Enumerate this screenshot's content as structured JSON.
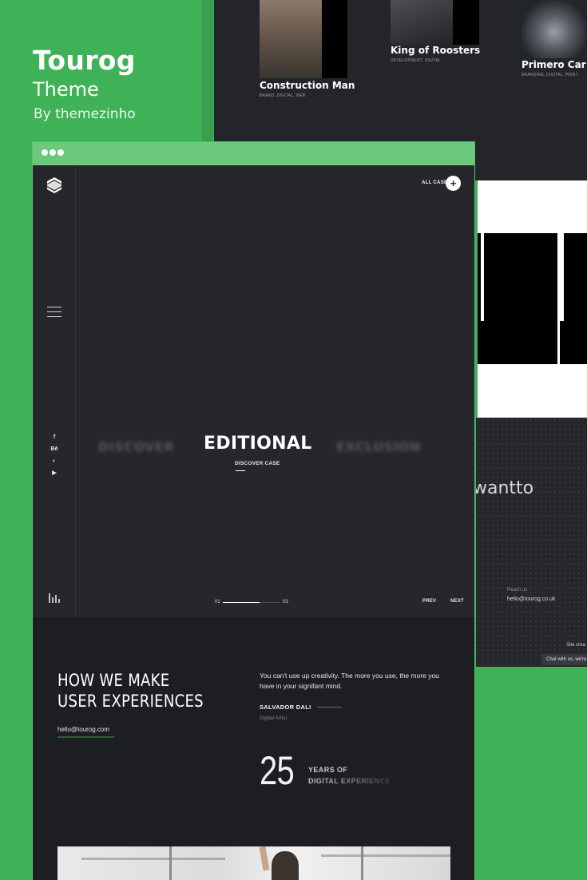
{
  "brand": {
    "title": "Tourog",
    "subtitle": "Theme",
    "byline": "By themezinho"
  },
  "back_preview": {
    "cases": [
      {
        "title": "Construction Man",
        "tags": "BRAND, DIGITAL, WEB"
      },
      {
        "title": "King of Roosters",
        "tags": "DEVELOPMENT, DIGITAL"
      },
      {
        "title": "Primero Car",
        "tags": "BRANDING, DIGITAL, PRINT"
      }
    ],
    "contact": {
      "heading": "wantto",
      "reach_label": "Reach us",
      "email": "hello@tourog.co.uk",
      "credit": "Site crea",
      "chat": "Chat with us, we're"
    }
  },
  "hero": {
    "all_cases_label": "ALL CASES",
    "plus_symbol": "+",
    "social": [
      "f",
      "Bē",
      "◐",
      "▶"
    ],
    "slides": {
      "prev": "DISCOVER",
      "current": "EDITIONAL",
      "next": "EXCLUSION"
    },
    "discover_case": "DISCOVER CASE",
    "progress": {
      "start": "01",
      "end": "03",
      "fraction": 0.65
    },
    "prev_label": "PREV",
    "next_label": "NEXT"
  },
  "about": {
    "heading": "HOW WE MAKE USER EXPERIENCES",
    "email": "hello@tourog.com",
    "quote": "You can't use up creativity. The more you use, the more you have in your signifant mind.",
    "author": "SALVADOR DALI",
    "author_role": "Digital Artist",
    "years_number": "25",
    "years_line1": "YEARS OF",
    "years_line2": "DIGITAL EXPERIENCE"
  },
  "colors": {
    "background_green": "#3fb257",
    "browser_bar": "#6cc97c",
    "hero_bg": "#26272c",
    "section_bg": "#1d1e22"
  }
}
